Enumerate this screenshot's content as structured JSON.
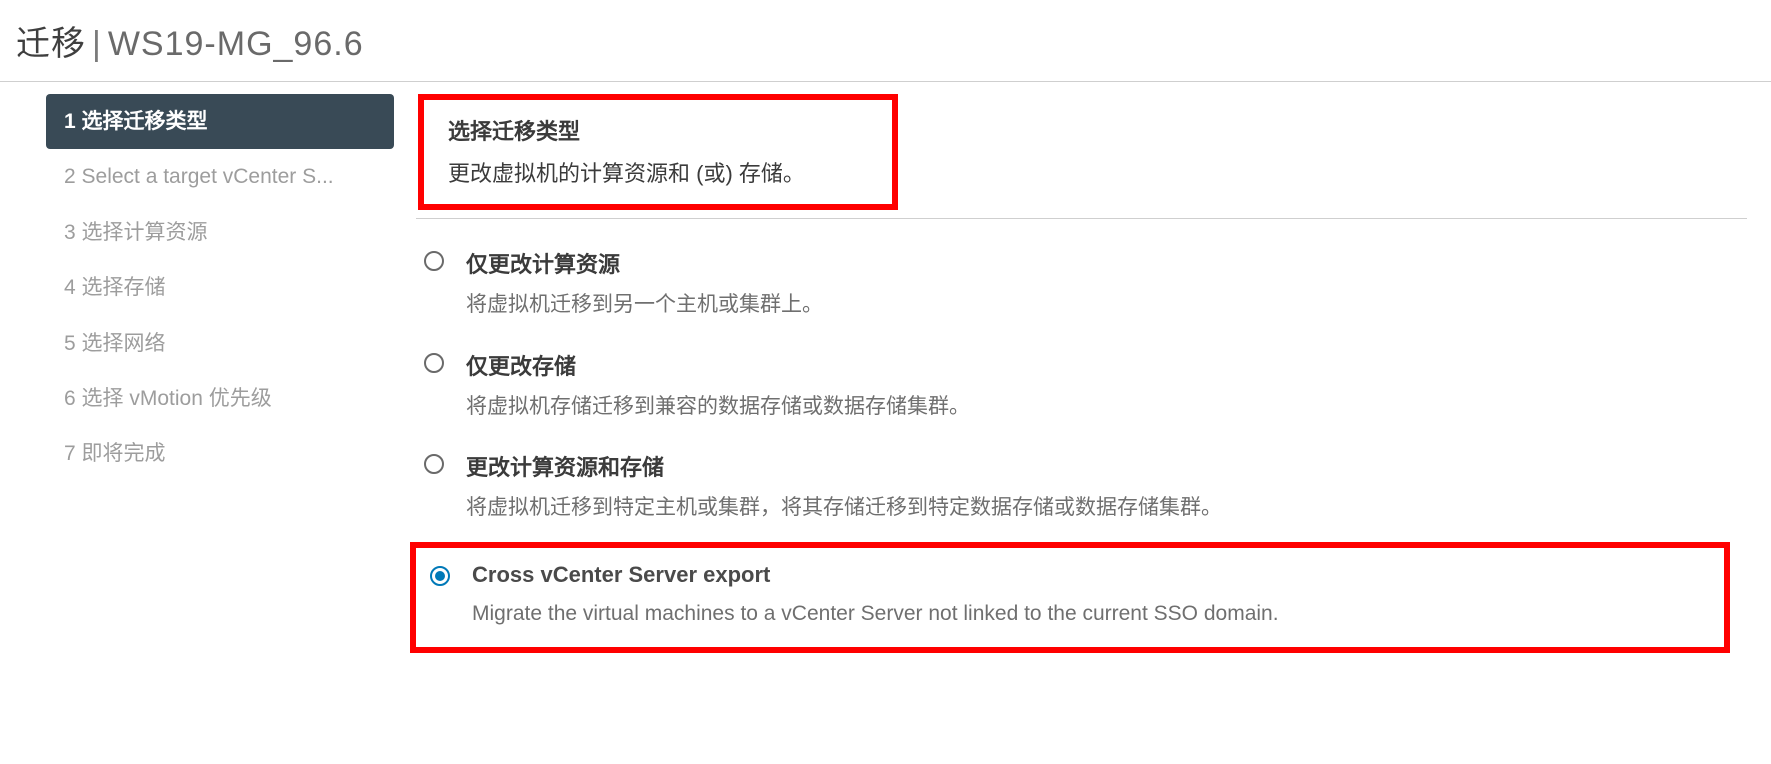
{
  "title": {
    "prefix": "迁移",
    "suffix": "WS19-MG_96.6"
  },
  "steps": [
    {
      "n": "1",
      "label": "选择迁移类型",
      "active": true
    },
    {
      "n": "2",
      "label": "Select a target vCenter S...",
      "active": false
    },
    {
      "n": "3",
      "label": "选择计算资源",
      "active": false
    },
    {
      "n": "4",
      "label": "选择存储",
      "active": false
    },
    {
      "n": "5",
      "label": "选择网络",
      "active": false
    },
    {
      "n": "6",
      "label": "选择 vMotion 优先级",
      "active": false
    },
    {
      "n": "7",
      "label": "即将完成",
      "active": false
    }
  ],
  "header": {
    "title": "选择迁移类型",
    "subtitle": "更改虚拟机的计算资源和 (或) 存储。"
  },
  "options": [
    {
      "id": "compute-only",
      "title": "仅更改计算资源",
      "desc": "将虚拟机迁移到另一个主机或集群上。",
      "selected": false,
      "boxed": false
    },
    {
      "id": "storage-only",
      "title": "仅更改存储",
      "desc": "将虚拟机存储迁移到兼容的数据存储或数据存储集群。",
      "selected": false,
      "boxed": false
    },
    {
      "id": "compute-storage",
      "title": "更改计算资源和存储",
      "desc": "将虚拟机迁移到特定主机或集群，将其存储迁移到特定数据存储或数据存储集群。",
      "selected": false,
      "boxed": false
    },
    {
      "id": "cross-vcenter",
      "title": "Cross vCenter Server export",
      "desc": "Migrate the virtual machines to a vCenter Server not linked to the current SSO domain.",
      "selected": true,
      "boxed": true
    }
  ]
}
